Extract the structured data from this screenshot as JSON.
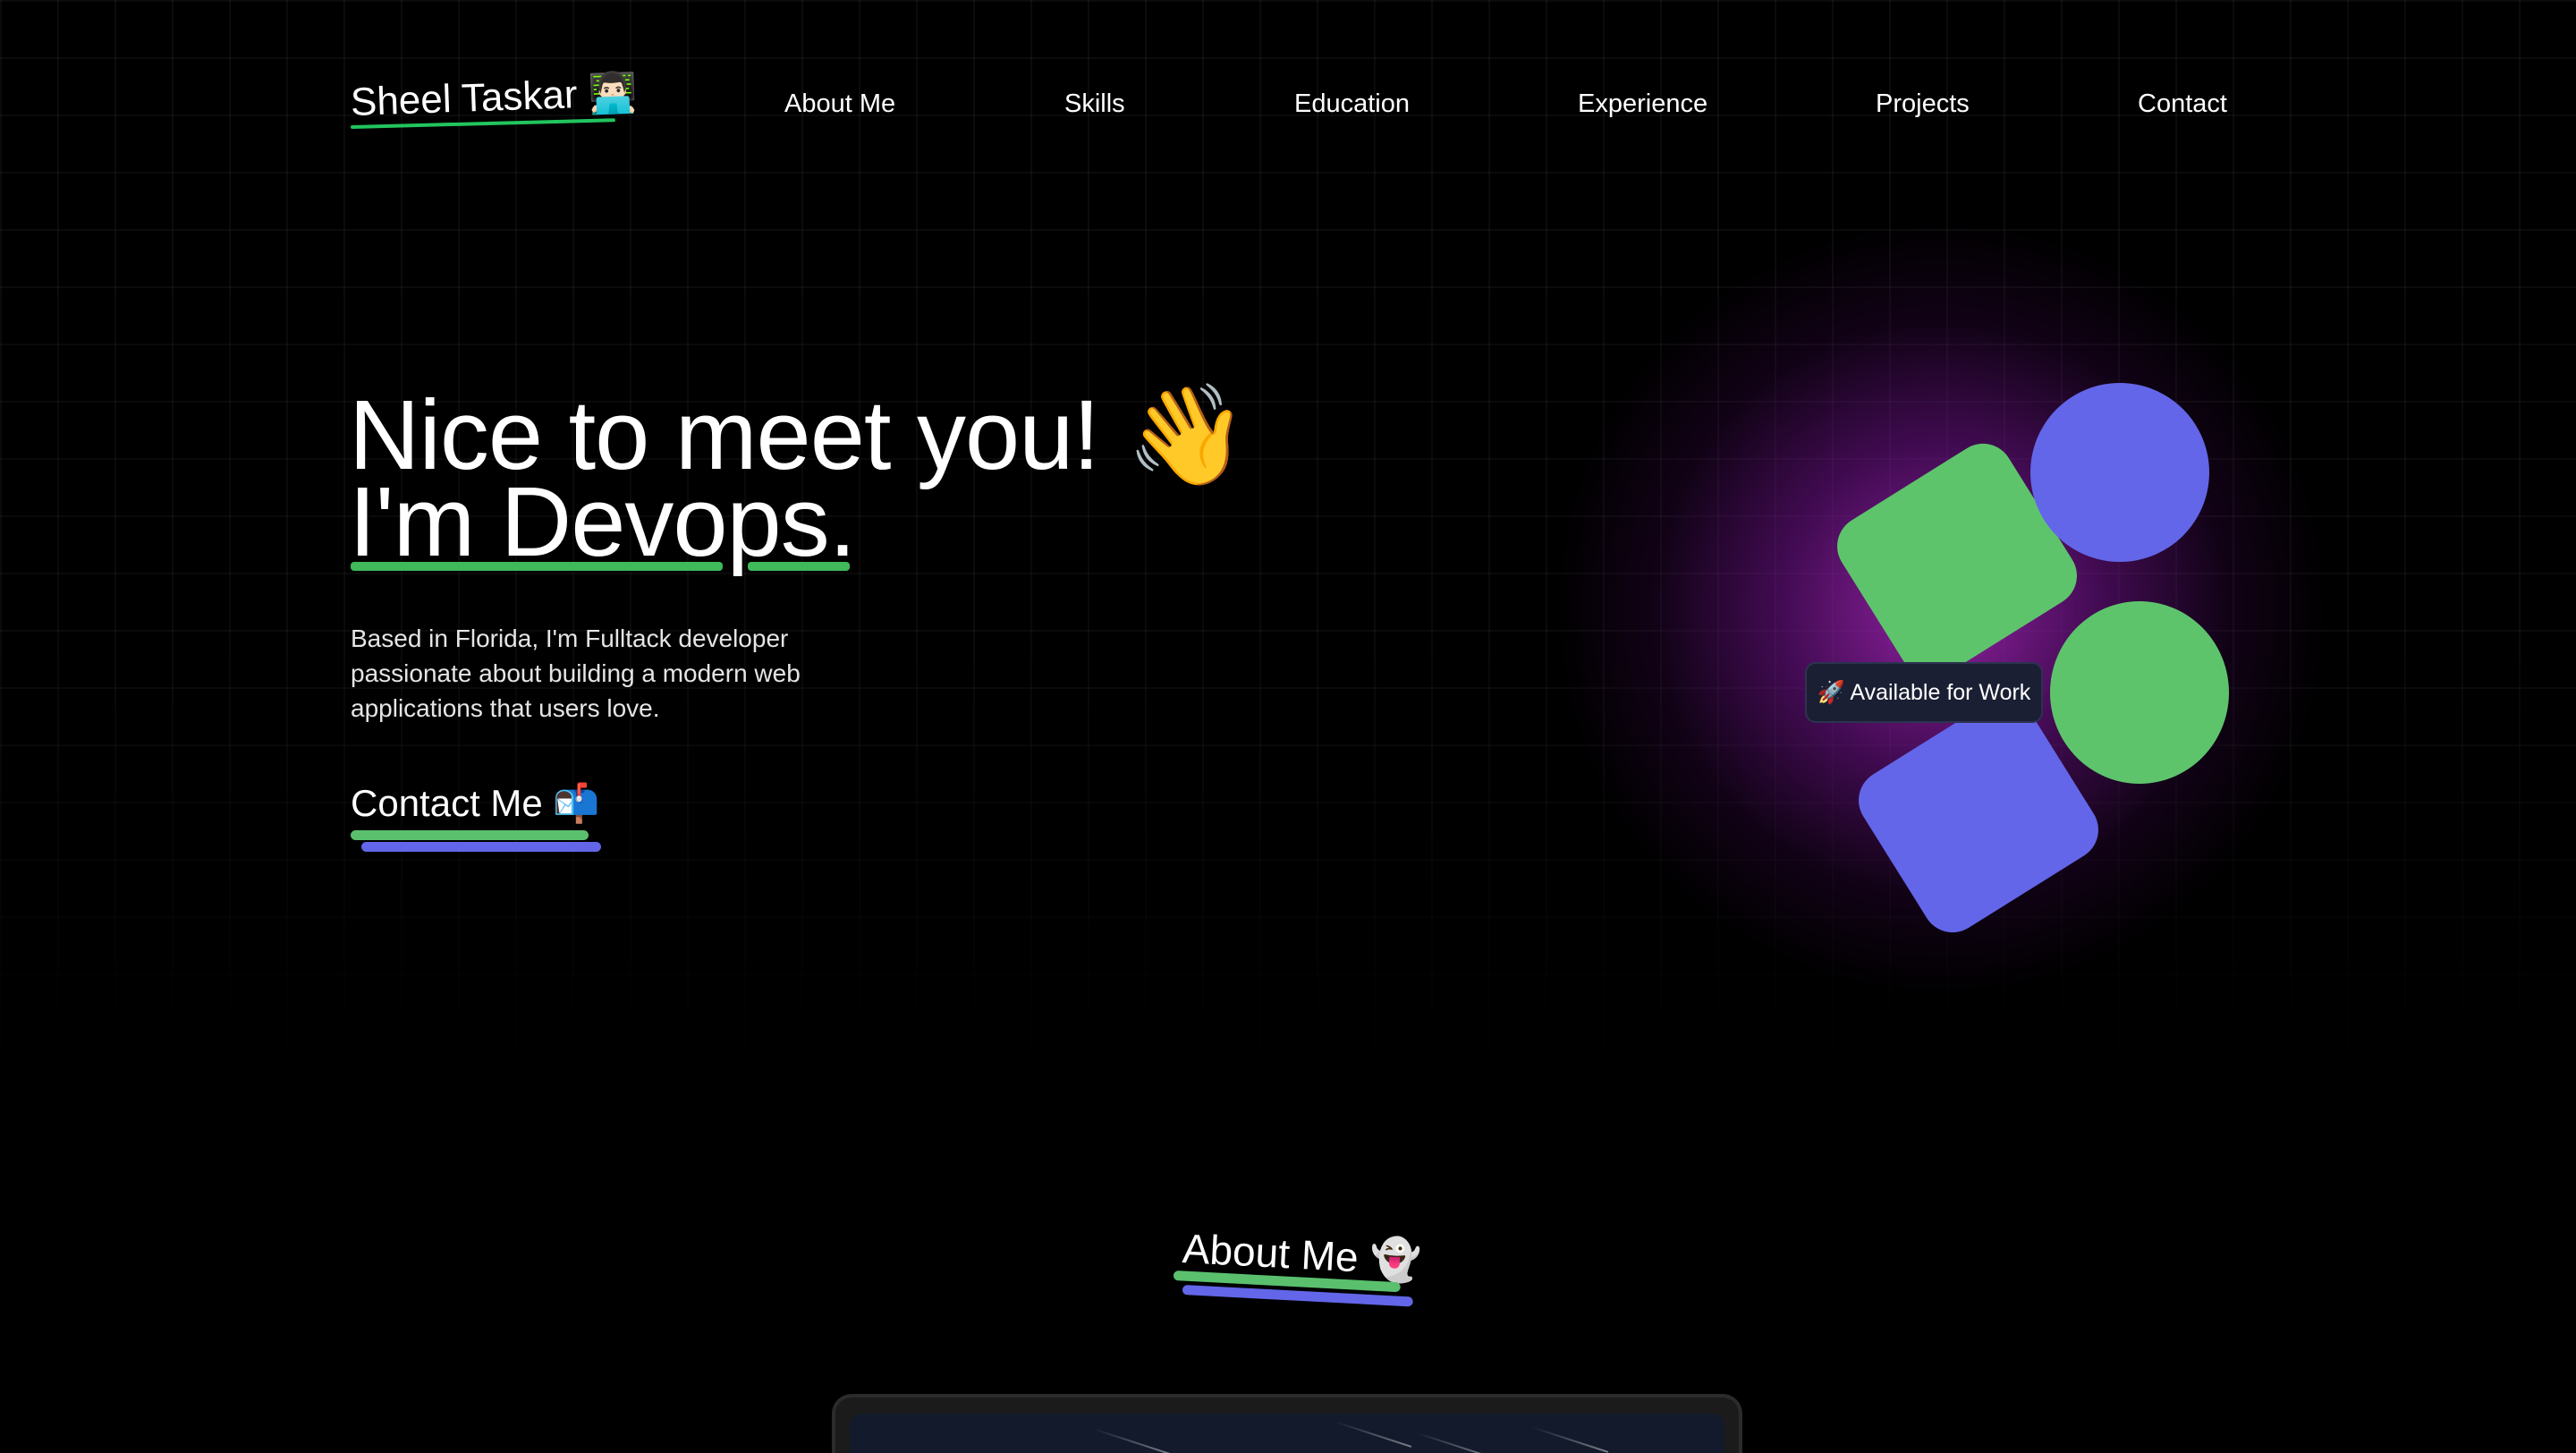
{
  "nav": {
    "logo_text": "Sheel Taskar 👨🏻‍💻",
    "links": [
      "About Me",
      "Skills",
      "Education",
      "Experience",
      "Projects",
      "Contact"
    ]
  },
  "hero": {
    "line1": "Nice to meet you! 👋",
    "line2": "I'm Devops.",
    "description": "Based in Florida, I'm Fulltack developer passionate about building a modern web applications that users love.",
    "cta_label": "Contact Me 📬"
  },
  "illustration": {
    "badge_label": "🚀 Available for Work"
  },
  "about": {
    "title": "About Me 👻"
  },
  "colors": {
    "background": "#000000",
    "accent_green": "#5ec46c",
    "accent_blue": "#6366e8",
    "glow_purple": "#aa28be",
    "badge_bg": "#1a1f33"
  }
}
